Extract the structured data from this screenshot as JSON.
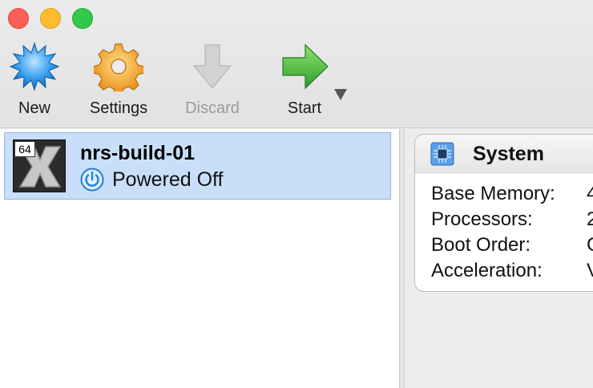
{
  "toolbar": {
    "new_label": "New",
    "settings_label": "Settings",
    "discard_label": "Discard",
    "start_label": "Start"
  },
  "vm_list": [
    {
      "name": "nrs-build-01",
      "state": "Powered Off",
      "os_badge": "64"
    }
  ],
  "details": {
    "section_title": "System",
    "properties": [
      {
        "key": "Base Memory:",
        "value": "4"
      },
      {
        "key": "Processors:",
        "value": "2"
      },
      {
        "key": "Boot Order:",
        "value": "C"
      },
      {
        "key": "Acceleration:",
        "value": "V"
      }
    ]
  },
  "colors": {
    "selection": "#c9dff9",
    "accent_blue": "#1f7fd6",
    "start_green": "#3cb043"
  },
  "icons": {
    "new": "new-vm-starburst-icon",
    "settings": "gear-icon",
    "discard": "discard-arrow-icon",
    "start": "start-arrow-icon",
    "power": "power-icon",
    "system": "chip-icon"
  }
}
